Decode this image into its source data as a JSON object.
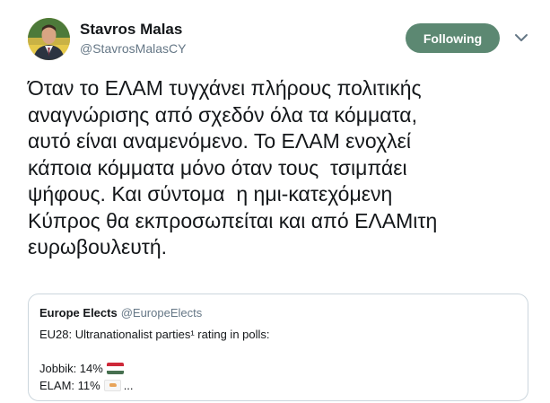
{
  "author": {
    "name": "Stavros Malas",
    "handle": "@StavrosMalasCY",
    "avatar_icon": "profile-photo"
  },
  "follow_button": {
    "label": "Following",
    "color": "#5c8872"
  },
  "menu": {
    "icon": "chevron-down-icon"
  },
  "tweet": {
    "lines": [
      "Όταν το ΕΛΑΜ τυγχάνει πλήρους πολιτικής",
      "αναγνώρισης από σχεδόν όλα τα κόμματα,",
      "αυτό είναι αναμενόμενο. Το ΕΛΑΜ ενοχλεί",
      "κάποια κόμματα μόνο όταν τους  τσιμπάει",
      "ψήφους. Και σύντομα  η ημι-κατεχόμενη",
      "Κύπρος θα εκπροσωπείται και από ΕΛΑΜιτη",
      "ευρωβουλευτή."
    ]
  },
  "quoted_tweet": {
    "author_name": "Europe Elects",
    "author_handle": "@EuropeElects",
    "line1": "EU28: Ultranationalist parties¹ rating in polls:",
    "line2": "Jobbik: 14%",
    "line2_flag": "hungary-flag-icon",
    "line3": "ELAM: 11%",
    "line3_flag": "cyprus-flag-icon",
    "line3_suffix": "..."
  },
  "colors": {
    "text": "#14171a",
    "secondary_text": "#657786",
    "border": "#ccd6dd"
  }
}
